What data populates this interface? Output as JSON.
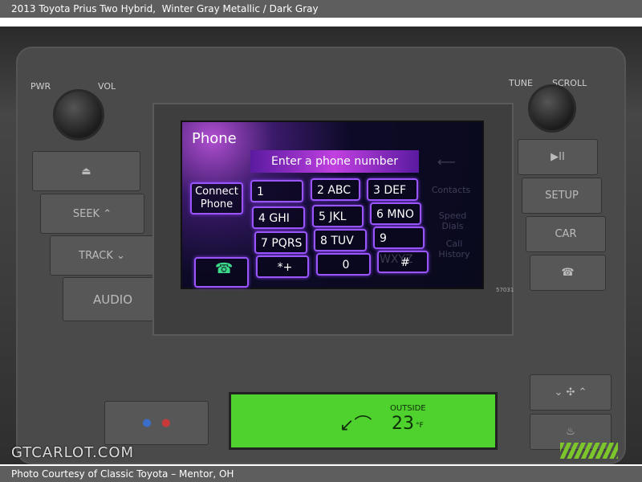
{
  "header": {
    "title": "2013 Toyota Prius Two Hybrid,",
    "color": "Winter Gray Metallic / Dark Gray"
  },
  "footer": {
    "credit": "Photo Courtesy of Classic Toyota – Mentor, OH"
  },
  "watermark": "GTCARLOT.COM",
  "dashboard": {
    "labels": {
      "pwr": "PWR",
      "vol": "VOL",
      "tune": "TUNE",
      "scroll": "SCROLL"
    },
    "left_buttons": [
      "⏏",
      "SEEK ⌃",
      "TRACK ⌄",
      "AUDIO"
    ],
    "right_buttons": [
      "▶II",
      "SETUP",
      "CAR",
      "☎"
    ],
    "screen": {
      "title": "Phone",
      "prompt": "Enter a phone number",
      "connect": "Connect Phone",
      "keys": [
        "1",
        "2  ABC",
        "3  DEF",
        "4  GHI",
        "5  JKL",
        "6  MNO",
        "7  PQRS",
        "8  TUV",
        "9  WXYZ",
        "*+",
        "0",
        "#"
      ],
      "side": [
        "Contacts",
        "Speed Dials",
        "Call History"
      ],
      "code": "57031"
    },
    "climate": {
      "outside_label": "OUTSIDE",
      "temp": "23",
      "unit": "°F"
    }
  }
}
